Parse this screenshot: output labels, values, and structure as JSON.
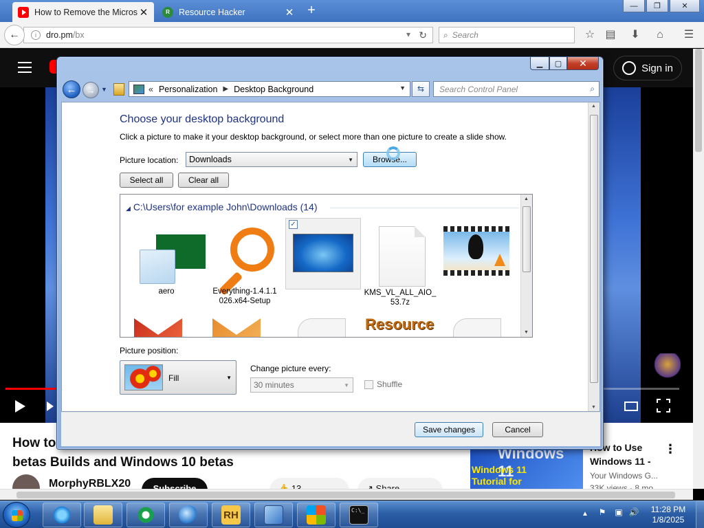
{
  "browser": {
    "tabs": [
      {
        "title": "How to Remove the Micros",
        "active": true
      },
      {
        "title": "Resource Hacker",
        "active": false
      }
    ],
    "url_host": "dro.pm",
    "url_path": "/bx",
    "search_placeholder": "Search"
  },
  "youtube": {
    "signin": "Sign in",
    "video_title_line1": "How to",
    "video_title_line2": "betas Builds and Windows 10 betas",
    "channel": "MorphyRBLX20",
    "subscribe": "Subscribe",
    "likes": "13",
    "share": "Share",
    "rec_thumb_big": "Windows 11",
    "rec_thumb_line1": "Windows 11",
    "rec_thumb_line2": "Tutorial for",
    "rec_title_line1": "How to Use",
    "rec_title_line2": "Windows 11 -",
    "rec_channel": "Your Windows G...",
    "rec_meta": "33K views · 8 mo..."
  },
  "window": {
    "breadcrumb_root": "«",
    "breadcrumb": [
      "Personalization",
      "Desktop Background"
    ],
    "search_placeholder": "Search Control Panel",
    "heading": "Choose your desktop background",
    "description": "Click a picture to make it your desktop background, or select more than one picture to create a slide show.",
    "picture_location_label": "Picture location:",
    "picture_location_value": "Downloads",
    "browse_label": "Browse...",
    "select_all_label": "Select all",
    "clear_all_label": "Clear all",
    "group_header": "C:\\Users\\for example John\\Downloads (14)",
    "tiles": [
      {
        "label": "aero"
      },
      {
        "label": "Everything-1.4.1.1 026.x64-Setup"
      },
      {
        "label": ""
      },
      {
        "label": "KMS_VL_ALL_AIO_ 53.7z"
      },
      {
        "label": ""
      }
    ],
    "row2_partial": "Resource",
    "picture_position_label": "Picture position:",
    "picture_position_value": "Fill",
    "change_every_label": "Change picture every:",
    "change_every_value": "30 minutes",
    "shuffle_label": "Shuffle",
    "save_label": "Save changes",
    "cancel_label": "Cancel"
  },
  "taskbar": {
    "rh_label": "RH",
    "cmd_label": "C:\\_",
    "time": "11:28 PM",
    "date": "1/8/2025"
  }
}
